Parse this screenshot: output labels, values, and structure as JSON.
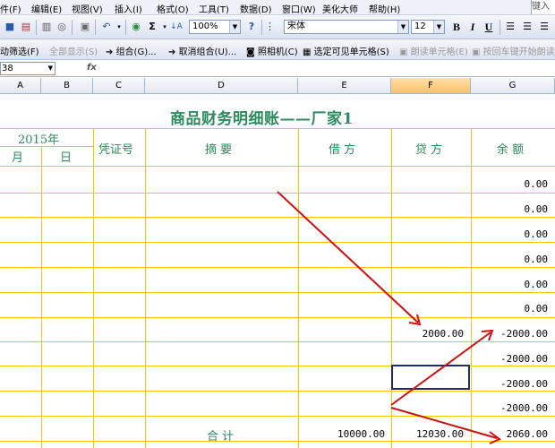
{
  "menubar": {
    "items": [
      "件(F)",
      "编辑(E)",
      "视图(V)",
      "插入(I)",
      "格式(O)",
      "工具(T)",
      "数据(D)",
      "窗口(W)",
      "美化大师",
      "帮助(H)"
    ],
    "help_box": "键入"
  },
  "toolbar1": {
    "zoom": "100%",
    "font_name": "宋体",
    "font_size": "12",
    "bold": "B",
    "italic": "I",
    "underline": "U",
    "sum": "Σ",
    "help": "?"
  },
  "toolbar2": {
    "items": [
      "动筛选(F)",
      "全部显示(S)",
      "组合(G)...",
      "取消组合(U)...",
      "照相机(C)",
      "选定可见单元格(S)",
      "朗读单元格(E)",
      "按回车键开始朗读"
    ]
  },
  "formula_bar": {
    "name_box": "38",
    "fx": "fx",
    "value": ""
  },
  "columns": [
    "A",
    "B",
    "C",
    "D",
    "E",
    "F",
    "G"
  ],
  "sheet": {
    "title": "商品财务明细账——厂家1",
    "header": {
      "year": "2015年",
      "month": "月",
      "day": "日",
      "voucher": "凭证号",
      "summary": "摘 要",
      "debit": "借 方",
      "credit": "贷 方",
      "balance": "余 额"
    },
    "rows": [
      {
        "debit": "",
        "credit": "",
        "balance": "0.00"
      },
      {
        "debit": "",
        "credit": "",
        "balance": "0.00"
      },
      {
        "debit": "",
        "credit": "",
        "balance": "0.00"
      },
      {
        "debit": "",
        "credit": "",
        "balance": "0.00"
      },
      {
        "debit": "",
        "credit": "",
        "balance": "0.00"
      },
      {
        "debit": "",
        "credit": "",
        "balance": "0.00"
      },
      {
        "debit": "",
        "credit": "2000.00",
        "balance": "-2000.00"
      },
      {
        "debit": "",
        "credit": "",
        "balance": "-2000.00"
      },
      {
        "debit": "",
        "credit": "",
        "balance": "-2000.00"
      },
      {
        "debit": "",
        "credit": "",
        "balance": "-2000.00"
      }
    ],
    "total": {
      "label": "合 计",
      "debit": "10000.00",
      "credit": "12030.00",
      "balance": "2060.00"
    }
  },
  "colors": {
    "grid_line": "#f0c800",
    "title_text": "#2d8a5c",
    "annotation_arrow": "#cc1111",
    "selection_border": "#1f2d6a"
  }
}
